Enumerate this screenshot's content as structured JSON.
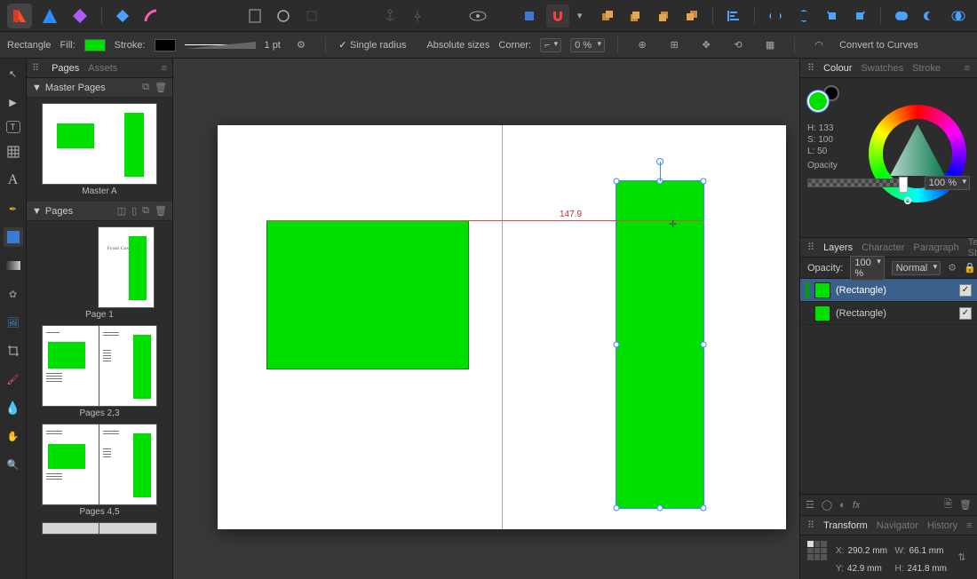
{
  "toolbar": {
    "snap_active": true
  },
  "context": {
    "shape_label": "Rectangle",
    "fill_label": "Fill:",
    "fill_color": "#00e000",
    "stroke_label": "Stroke:",
    "stroke_color": "#000000",
    "stroke_weight": "1 pt",
    "single_radius_label": "Single radius",
    "absolute_sizes_label": "Absolute sizes",
    "corner_label": "Corner:",
    "corner_percent": "0 %",
    "convert_label": "Convert to Curves"
  },
  "left_panel": {
    "tabs": [
      "Pages",
      "Assets"
    ],
    "active_tab": "Pages",
    "master_section": "Master Pages",
    "pages_section": "Pages",
    "masters": [
      {
        "label": "Master A"
      }
    ],
    "pages": [
      {
        "label": "Page 1",
        "cover_text": "Front Cover"
      },
      {
        "label": "Pages 2,3"
      },
      {
        "label": "Pages 4,5"
      }
    ]
  },
  "canvas": {
    "dimension_readout": "147.9"
  },
  "right": {
    "colour_tabs": [
      "Colour",
      "Swatches",
      "Stroke"
    ],
    "colour_active": "Colour",
    "hsl": {
      "h": "H: 133",
      "s": "S: 100",
      "l": "L: 50"
    },
    "opacity_label": "Opacity",
    "opacity_value": "100 %",
    "layers_tabs": [
      "Layers",
      "Character",
      "Paragraph",
      "Text Styles"
    ],
    "layers_active": "Layers",
    "layer_opacity_label": "Opacity:",
    "layer_opacity_value": "100 %",
    "blend_label": "Normal",
    "layers": [
      {
        "name": "(Rectangle)",
        "selected": true
      },
      {
        "name": "(Rectangle)",
        "selected": false
      }
    ],
    "transform_tabs": [
      "Transform",
      "Navigator",
      "History"
    ],
    "transform_active": "Transform",
    "x_label": "X:",
    "x_val": "290.2 mm",
    "y_label": "Y:",
    "y_val": "42.9 mm",
    "w_label": "W:",
    "w_val": "66.1 mm",
    "h_label": "H:",
    "h_val": "241.8 mm"
  }
}
